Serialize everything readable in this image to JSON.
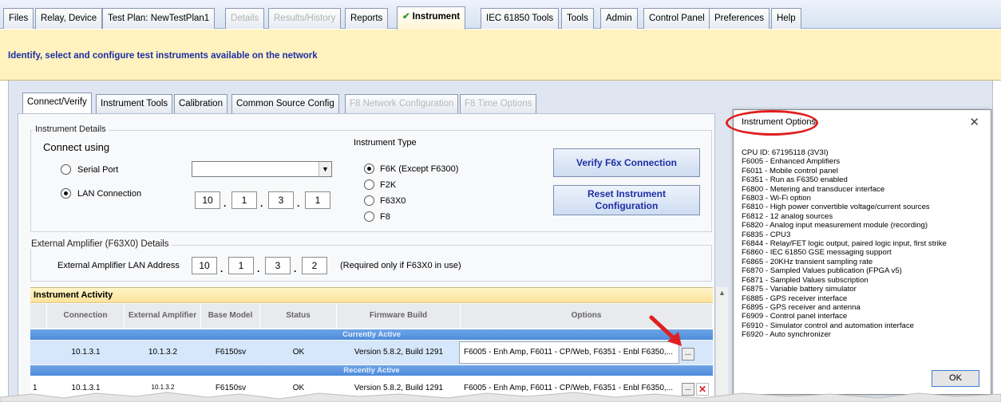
{
  "top_tabs": [
    {
      "label": "Files",
      "state": "normal"
    },
    {
      "label": "Relay, Device",
      "state": "normal"
    },
    {
      "label": "Test Plan: NewTestPlan1",
      "state": "normal"
    },
    {
      "label": "Details",
      "state": "disabled"
    },
    {
      "label": "Results/History",
      "state": "disabled"
    },
    {
      "label": "Reports",
      "state": "normal"
    },
    {
      "label": "Instrument",
      "state": "active"
    },
    {
      "label": "IEC 61850 Tools",
      "state": "normal"
    },
    {
      "label": "Tools",
      "state": "normal"
    },
    {
      "label": "Admin",
      "state": "normal"
    },
    {
      "label": "Control Panel",
      "state": "normal"
    },
    {
      "label": "Preferences",
      "state": "normal"
    },
    {
      "label": "Help",
      "state": "normal"
    }
  ],
  "banner": "Identify, select and configure test instruments available on the network",
  "sub_tabs": [
    {
      "label": "Connect/Verify",
      "state": "active"
    },
    {
      "label": "Instrument Tools",
      "state": "normal"
    },
    {
      "label": "Calibration",
      "state": "normal"
    },
    {
      "label": "Common Source Config",
      "state": "normal"
    },
    {
      "label": "F8 Network Configuration",
      "state": "disabled"
    },
    {
      "label": "F8 Time Options",
      "state": "disabled"
    }
  ],
  "instrument_details": {
    "group_label": "Instrument Details",
    "connect_using": "Connect using",
    "serial_port": "Serial Port",
    "lan_connection": "LAN Connection",
    "lan_selected": true,
    "ip": [
      "10",
      "1",
      "3",
      "1"
    ],
    "instrument_type_label": "Instrument Type",
    "types": [
      "F6K (Except F6300)",
      "F2K",
      "F63X0",
      "F8"
    ],
    "selected_type": "F6K (Except F6300)",
    "verify_button": "Verify F6x Connection",
    "reset_button_line1": "Reset Instrument",
    "reset_button_line2": "Configuration"
  },
  "external_amplifier": {
    "group_label": "External Amplifier (F63X0) Details",
    "address_label": "External Amplifier LAN Address",
    "ip": [
      "10",
      "1",
      "3",
      "2"
    ],
    "note": "(Required only if F63X0 in use)"
  },
  "activity": {
    "title": "Instrument Activity",
    "columns": [
      "Connection",
      "External Amplifier",
      "Base Model",
      "Status",
      "Firmware Build",
      "Options"
    ],
    "currently_active_label": "Currently Active",
    "recently_active_label": "Recently Active",
    "current_row": {
      "connection": "10.1.3.1",
      "external_amplifier": "10.1.3.2",
      "base_model": "F6150sv",
      "status": "OK",
      "firmware": "Version 5.8.2, Build 1291",
      "options": "F6005 - Enh Amp, F6011 - CP/Web, F6351 - Enbl F6350,..."
    },
    "recent_row": {
      "index": "1",
      "connection": "10.1.3.1",
      "external_amplifier": "10.1.3.2",
      "base_model": "F6150sv",
      "status": "OK",
      "firmware": "Version 5.8.2, Build 1291",
      "options": "F6005 - Enh Amp, F6011 - CP/Web, F6351 - Enbl F6350,..."
    },
    "ellipsis": "...",
    "remove": "✕"
  },
  "dialog": {
    "title": "Instrument Options",
    "close": "✕",
    "ok": "OK",
    "lines": [
      "CPU ID: 67195118 (3V3I)",
      "F6005 - Enhanced Amplifiers",
      "F6011 - Mobile control panel",
      "F6351 - Run as F6350 enabled",
      "F6800 - Metering and transducer interface",
      "F6803 - Wi-Fi option",
      "F6810 - High power convertible voltage/current sources",
      "F6812 - 12 analog sources",
      "F6820 - Analog input measurement module (recording)",
      "F6835 - CPU3",
      "F6844 - Relay/FET logic output, paired logic input, first strike",
      "F6860 - IEC 61850 GSE messaging support",
      "F6865 - 20KHz transient sampling  rate",
      "F6870 - Sampled Values publication (FPGA v5)",
      "F6871 - Sampled Values subscription",
      "F6875 - Variable battery simulator",
      "F6885 - GPS receiver interface",
      "F6895 - GPS receiver and antenna",
      "F6909 - Control panel interface",
      "F6910 - Simulator control and automation interface",
      "F6920 - Auto synchronizer"
    ]
  },
  "colors": {
    "banner_bg": "#fff2bf",
    "banner_text": "#1d2fa3",
    "section_blue": "#4d8bdb",
    "annotation_red": "#e02020"
  }
}
